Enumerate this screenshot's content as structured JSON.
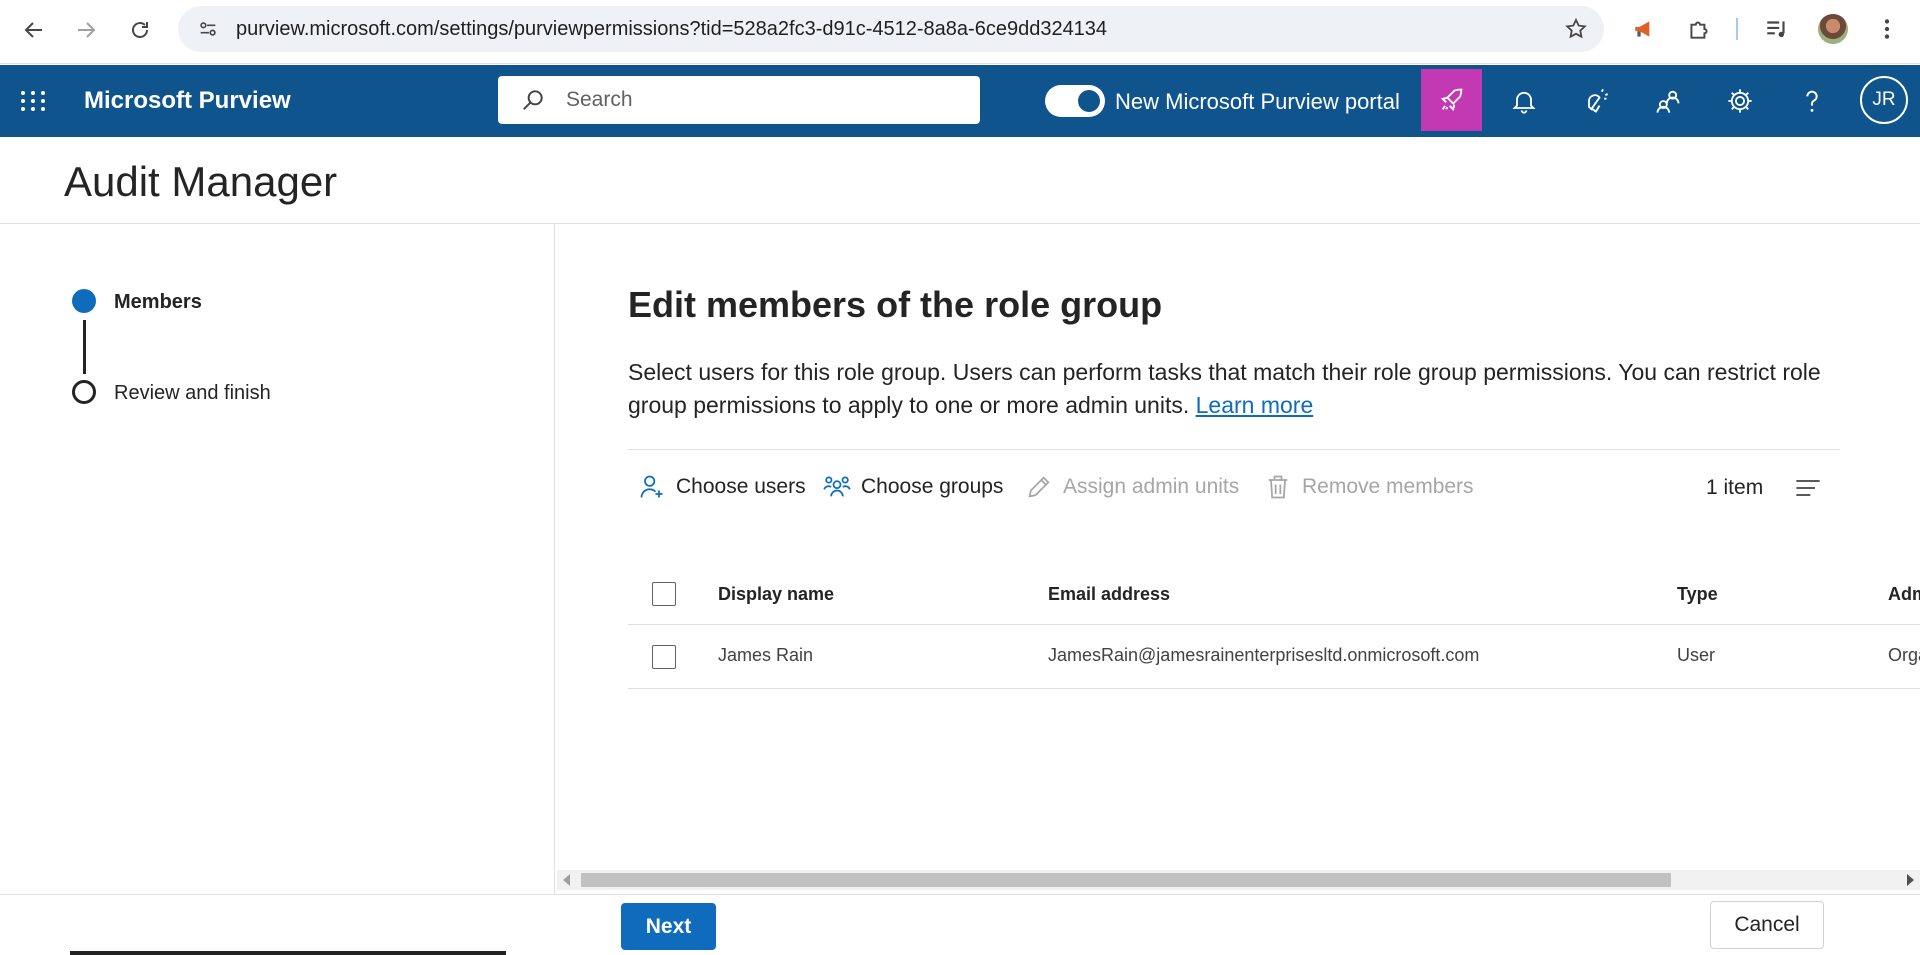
{
  "browser": {
    "url": "purview.microsoft.com/settings/purviewpermissions?tid=528a2fc3-d91c-4512-8a8a-6ce9dd324134"
  },
  "header": {
    "app_name": "Microsoft Purview",
    "search_placeholder": "Search",
    "toggle_label": "New Microsoft Purview portal",
    "avatar_initials": "JR"
  },
  "page": {
    "title": "Audit Manager"
  },
  "stepper": {
    "steps": [
      {
        "label": "Members",
        "state": "current"
      },
      {
        "label": "Review and finish",
        "state": "pending"
      }
    ]
  },
  "main": {
    "heading": "Edit members of the role group",
    "description": "Select users for this role group. Users can perform tasks that match their role group permissions. You can restrict role group permissions to apply to one or more admin units.",
    "learn_more": "Learn more"
  },
  "toolbar": {
    "choose_users": "Choose users",
    "choose_groups": "Choose groups",
    "assign_admin_units": "Assign admin units",
    "remove_members": "Remove members",
    "item_count": "1 item"
  },
  "table": {
    "columns": [
      "Display name",
      "Email address",
      "Type",
      "Adm"
    ],
    "rows": [
      {
        "display_name": "James Rain",
        "email": "JamesRain@jamesrainenterprisesltd.onmicrosoft.com",
        "type": "User",
        "admin_units": "Orga"
      }
    ]
  },
  "footer": {
    "next": "Next",
    "cancel": "Cancel"
  },
  "colors": {
    "header_bg": "#0f548c",
    "accent": "#0f6cbd",
    "rocket_bg": "#c239b3"
  }
}
